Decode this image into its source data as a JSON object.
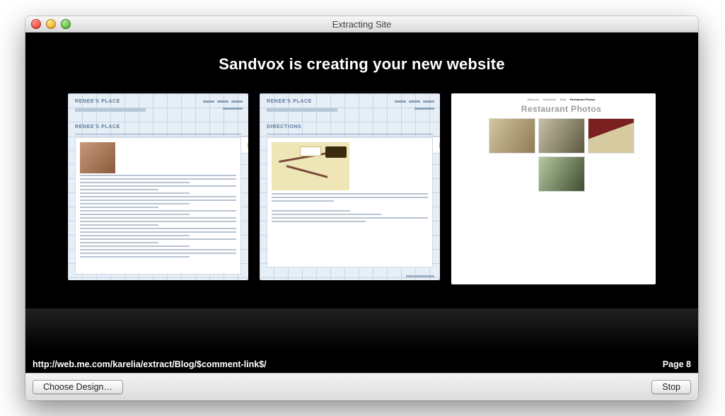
{
  "window": {
    "title": "Extracting Site"
  },
  "headline": "Sandvox is creating your new website",
  "status": {
    "url": "http://web.me.com/karelia/extract/Blog/$comment-link$/",
    "page_label": "Page 8"
  },
  "buttons": {
    "choose_design": "Choose Design…",
    "stop": "Stop"
  },
  "previews": [
    {
      "site_title": "RENEE'S PLACE",
      "section": "RENEE'S PLACE"
    },
    {
      "site_title": "RENEE'S PLACE",
      "section": "DIRECTIONS"
    },
    {
      "nav": [
        "Welcome",
        "Directions",
        "Blog",
        "Restaurant Photos"
      ],
      "title": "Restaurant Photos"
    }
  ]
}
